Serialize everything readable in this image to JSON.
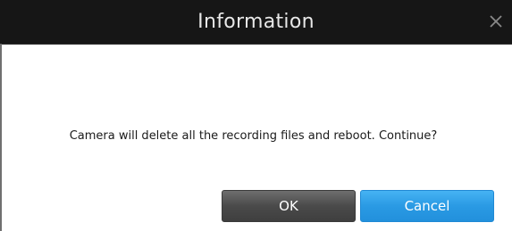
{
  "dialog": {
    "title": "Information",
    "close_icon": "close-icon",
    "message": "Camera will delete all the recording files and reboot. Continue?",
    "buttons": {
      "ok_label": "OK",
      "cancel_label": "Cancel"
    },
    "colors": {
      "title_bar": "#161616",
      "ok_button": "#4a4a4a",
      "cancel_button": "#2a9ae4"
    }
  }
}
